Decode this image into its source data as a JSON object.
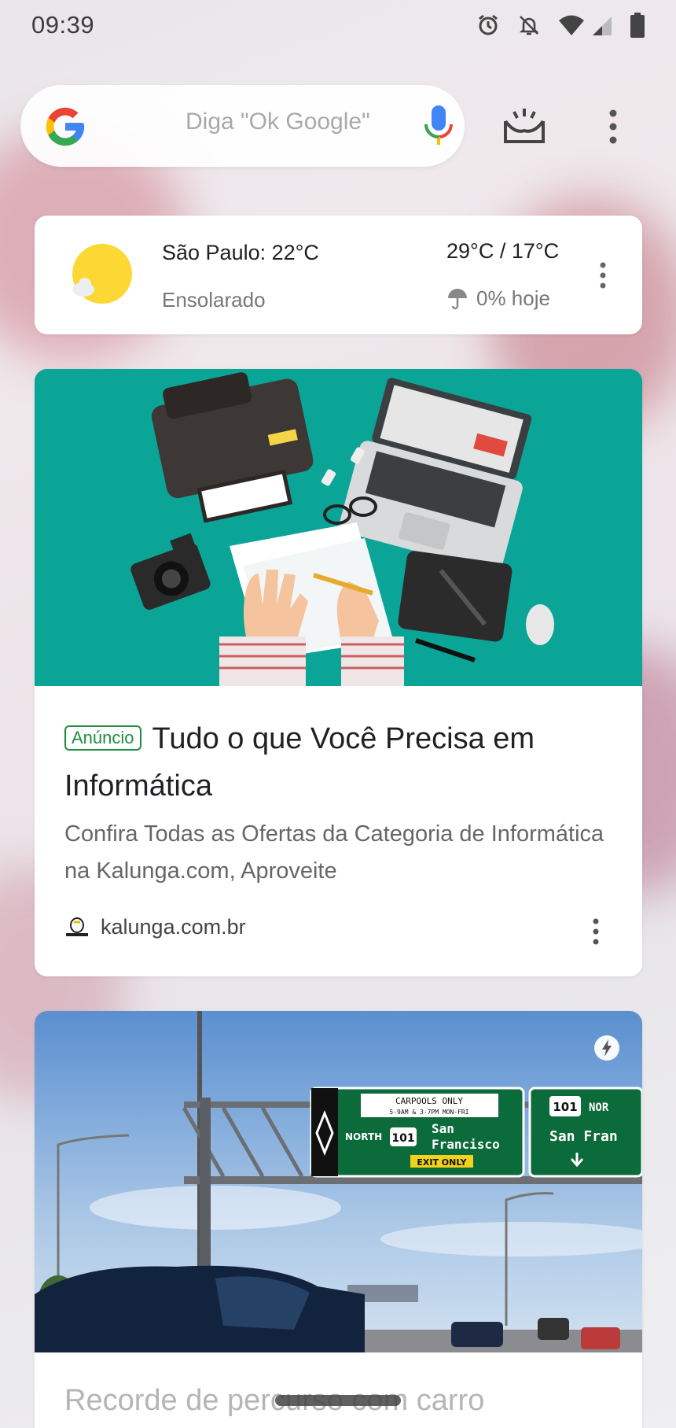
{
  "status_bar": {
    "time": "09:39",
    "icons": [
      "alarm-icon",
      "notifications-off-icon",
      "wifi-icon",
      "signal-icon",
      "battery-icon"
    ]
  },
  "search": {
    "placeholder": "Diga \"Ok Google\""
  },
  "weather": {
    "city_temp": "São Paulo: 22°C",
    "condition": "Ensolarado",
    "range": "29°C / 17°C",
    "precipitation": "0% hoje"
  },
  "ad": {
    "badge": "Anúncio",
    "title": "Tudo o que Você Precisa em Informática",
    "description": "Confira Todas as Ofertas da Categoria de Informática na Kalunga.com, Aproveite",
    "source": "kalunga.com.br"
  },
  "news": {
    "sign_top": "CARPOOLS ONLY",
    "sign_hours": "5-9AM & 3-7PM MON-FRI",
    "sign_dir": "NORTH",
    "sign_route": "101",
    "sign_city1": "San",
    "sign_city2": "Francisco",
    "sign_exit": "EXIT ONLY",
    "sign2_route": "101",
    "sign2_dir": "NOR",
    "sign2_city": "San Fran",
    "title": "Recorde de percurso com carro"
  },
  "colors": {
    "ad_bg": "#0aa597",
    "ad_badge": "#1e8e3e"
  }
}
